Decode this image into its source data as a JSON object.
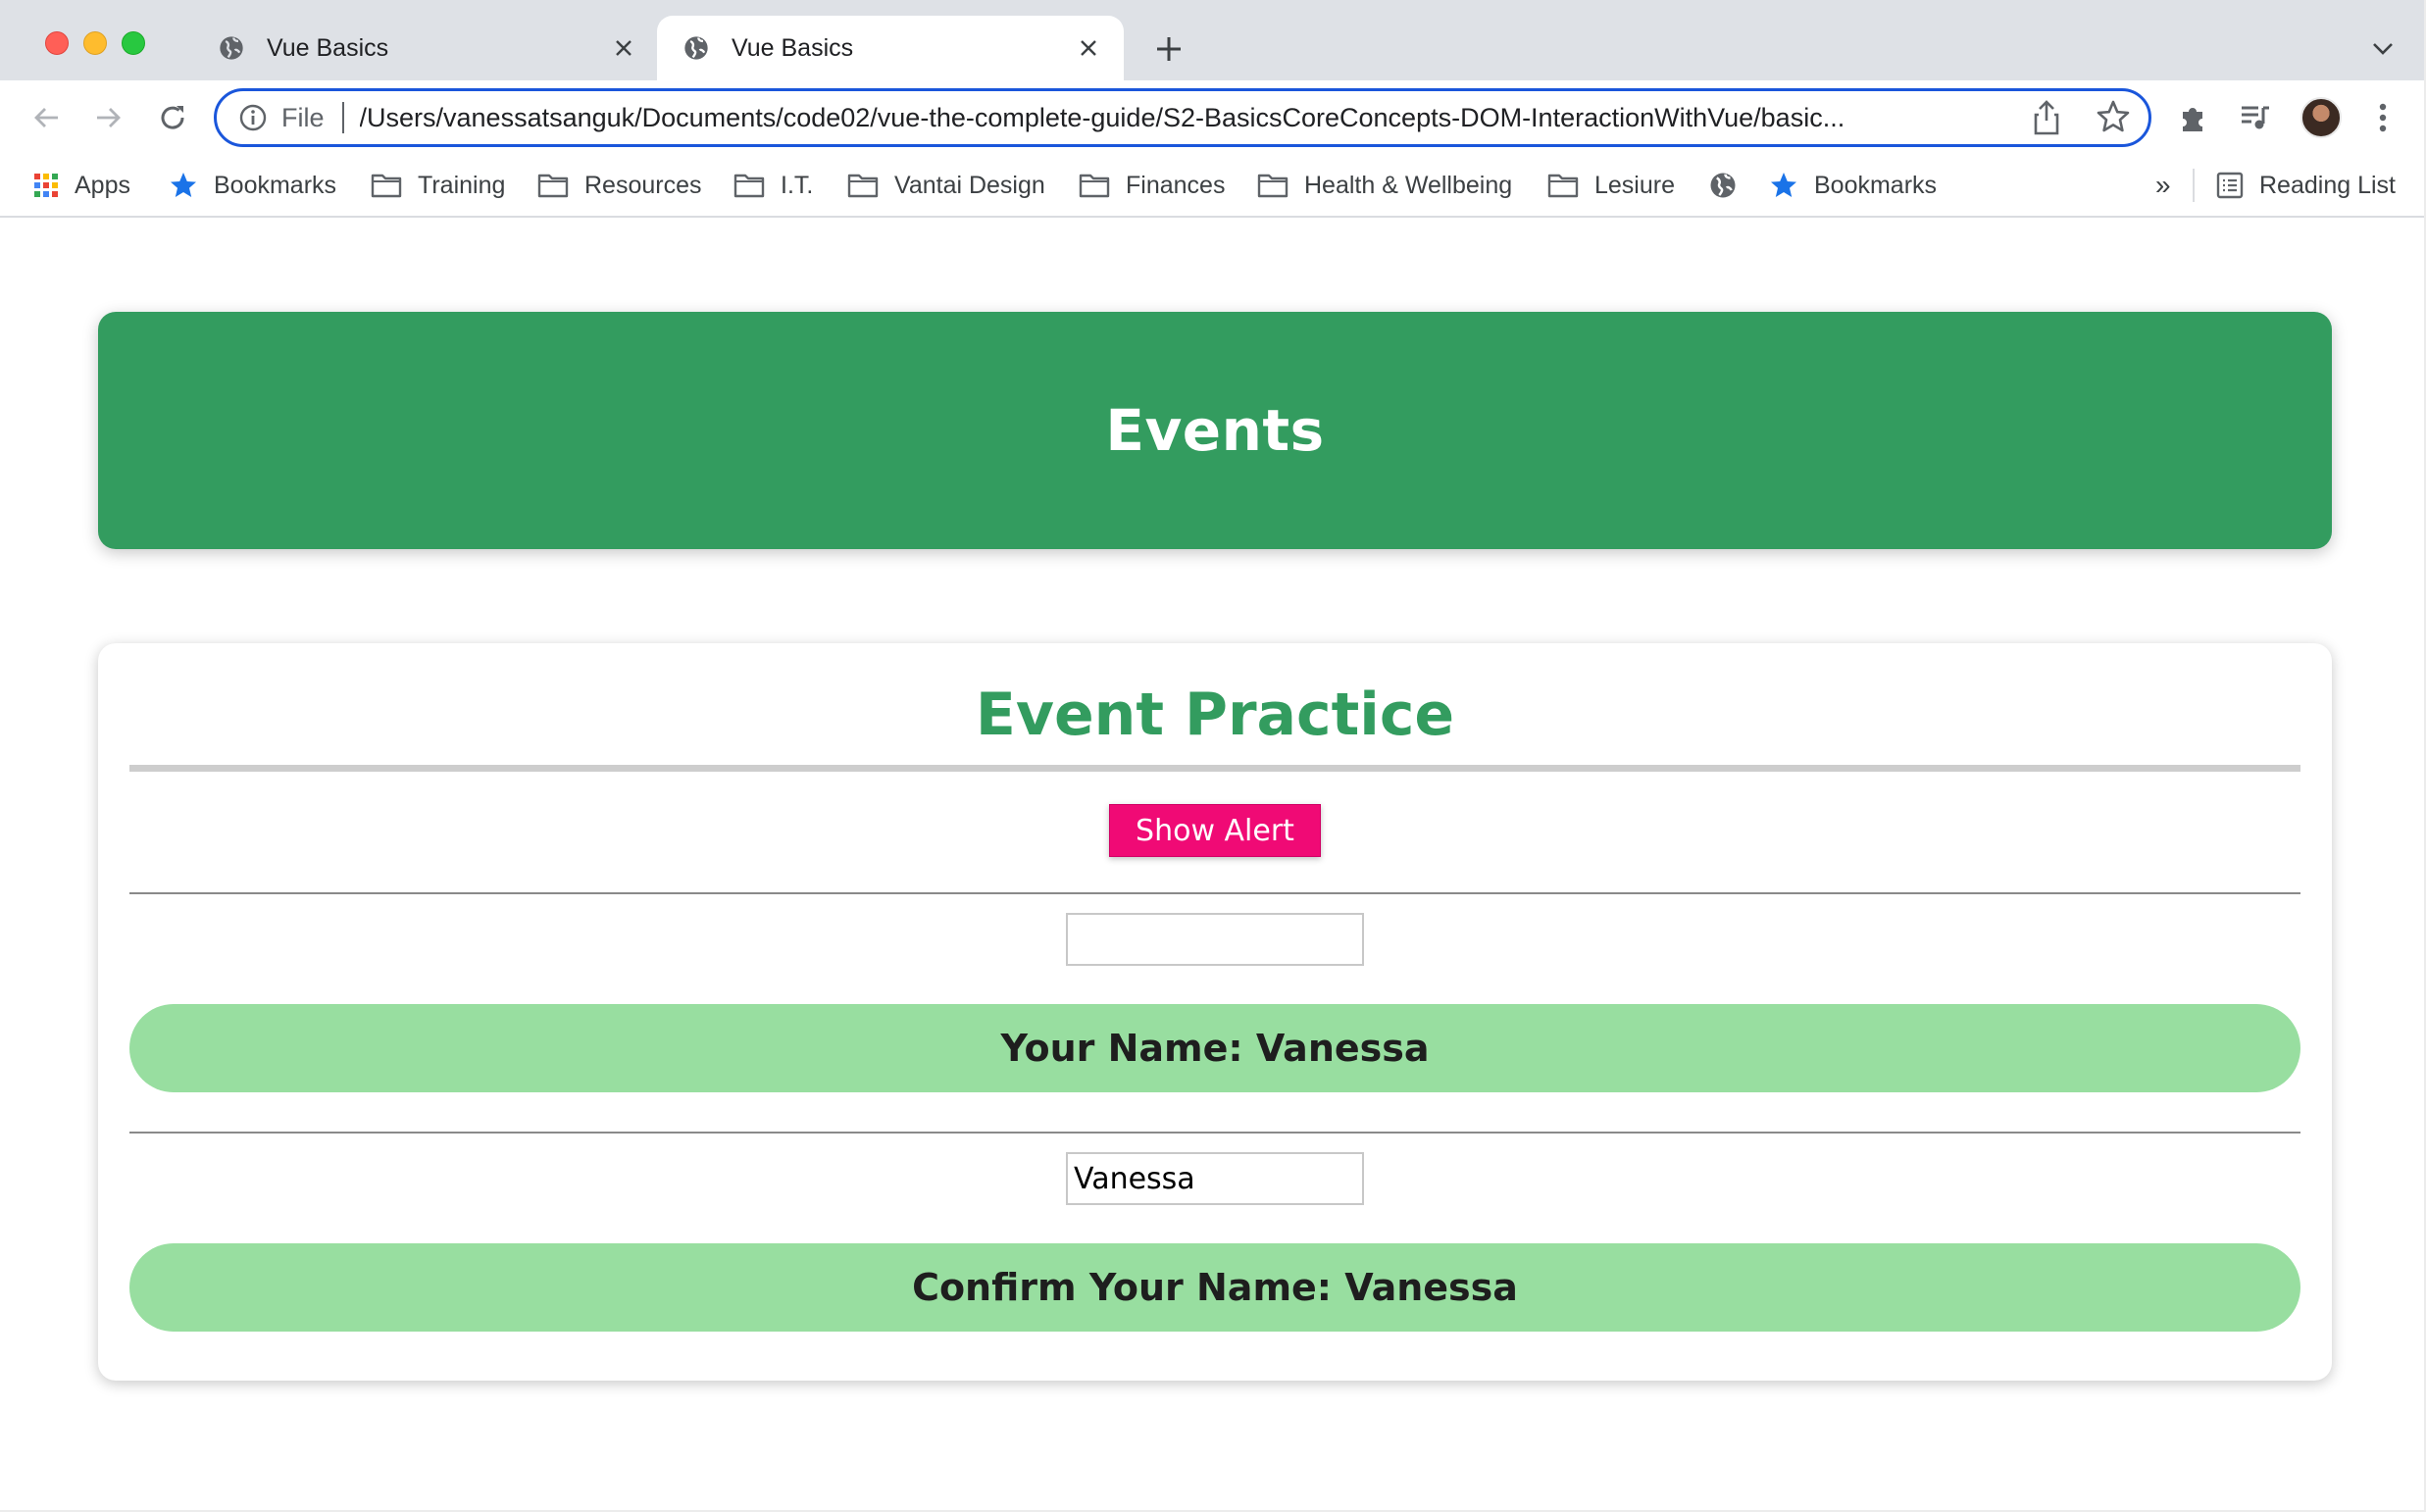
{
  "browser": {
    "tabs": [
      {
        "title": "Vue Basics",
        "active": false
      },
      {
        "title": "Vue Basics",
        "active": true
      }
    ],
    "omnibox": {
      "scheme": "File",
      "url": "/Users/vanessatsanguk/Documents/code02/vue-the-complete-guide/S2-BasicsCoreConcepts-DOM-InteractionWithVue/basic..."
    },
    "bookmarks": [
      {
        "label": "Apps",
        "icon": "apps-grid-icon"
      },
      {
        "label": "Bookmarks",
        "icon": "star-icon"
      },
      {
        "label": "Training",
        "icon": "folder-icon"
      },
      {
        "label": "Resources",
        "icon": "folder-icon"
      },
      {
        "label": "I.T.",
        "icon": "folder-icon"
      },
      {
        "label": "Vantai Design",
        "icon": "folder-icon"
      },
      {
        "label": "Finances",
        "icon": "folder-icon"
      },
      {
        "label": "Health & Wellbeing",
        "icon": "folder-icon"
      },
      {
        "label": "Lesiure",
        "icon": "folder-icon"
      },
      {
        "label": "",
        "icon": "globe-icon"
      },
      {
        "label": "Bookmarks",
        "icon": "star-icon"
      }
    ],
    "overflow_label": "»",
    "reading_list_label": "Reading List"
  },
  "page": {
    "header_title": "Events",
    "card_title": "Event Practice",
    "alert_button_label": "Show Alert",
    "first_input": {
      "value": "",
      "placeholder": ""
    },
    "your_name_text": "Your Name: Vanessa",
    "second_input": {
      "value": "Vanessa"
    },
    "confirm_name_text": "Confirm Your Name: Vanessa"
  },
  "colors": {
    "header_green": "#339c5f",
    "name_pill_green": "#98dea0",
    "alert_pink": "#f00a75",
    "omnibox_focus": "#1a56db"
  }
}
